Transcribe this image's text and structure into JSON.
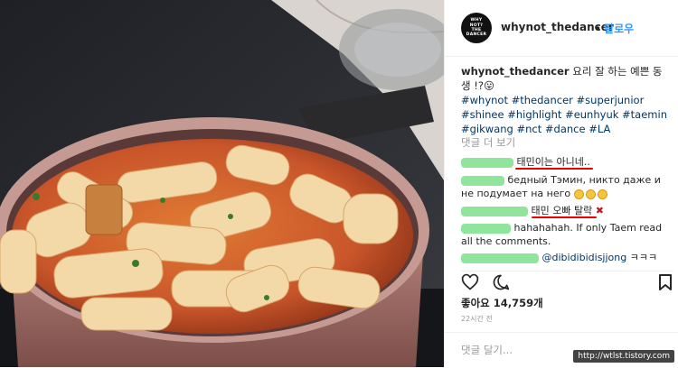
{
  "post": {
    "username": "whynot_thedancer",
    "follow_separator": "•",
    "follow_label": "팔로우",
    "avatar_text": "WHY NOT? THE DANCER",
    "caption_user": "whynot_thedancer",
    "caption_text": "요리 잘 하는 예쁜 동생 !?😛",
    "hashtags": "#whynot #thedancer #superjunior #shinee #highlight #eunhyuk #taemin #gikwang #nct #dance #LA",
    "view_more": "댓글 더 보기"
  },
  "comments": [
    {
      "text": "태민이는 아니네.."
    },
    {
      "text": "бедный Тэмин, никто даже и не подумает на него"
    },
    {
      "text": "태민 오빠 탈락"
    },
    {
      "text": "hahahahah. If only Taem read all the comments."
    },
    {
      "mention": "@dibidibidisjjong",
      "text": "ㅋㅋㅋ"
    }
  ],
  "likes_label": "좋아요",
  "likes_count": "14,759개",
  "time_ago": "22시간 전",
  "add_comment_placeholder": "댓글 달기...",
  "watermark": "http://wtlst.tistory.com",
  "colors": {
    "link": "#3897f0",
    "hashtag": "#003569",
    "blur": "#8fe59b",
    "underline": "#e00000"
  }
}
